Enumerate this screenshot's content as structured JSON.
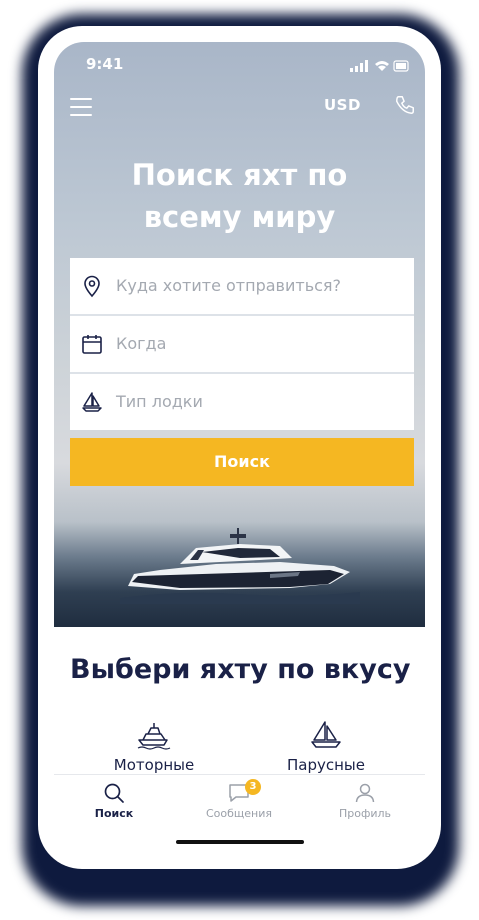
{
  "status_bar": {
    "time": "9:41"
  },
  "header": {
    "currency": "USD"
  },
  "hero": {
    "title_line1": "Поиск яхт по",
    "title_line2": "всему миру"
  },
  "search_form": {
    "destination_placeholder": "Куда хотите отправиться?",
    "date_placeholder": "Когда",
    "boat_type_placeholder": "Тип лодки",
    "submit_label": "Поиск"
  },
  "section": {
    "title": "Выбери яхту по вкусу",
    "categories": [
      {
        "label": "Моторные",
        "icon": "motor-yacht-icon"
      },
      {
        "label": "Парусные",
        "icon": "sailboat-icon"
      }
    ]
  },
  "tab_bar": {
    "tabs": [
      {
        "label": "Поиск",
        "icon": "search-icon",
        "active": true
      },
      {
        "label": "Сообщения",
        "icon": "chat-icon",
        "badge": "3"
      },
      {
        "label": "Профиль",
        "icon": "user-icon"
      }
    ]
  },
  "colors": {
    "accent": "#f5b722",
    "navy": "#1a2147",
    "placeholder": "#a4a9b1"
  }
}
